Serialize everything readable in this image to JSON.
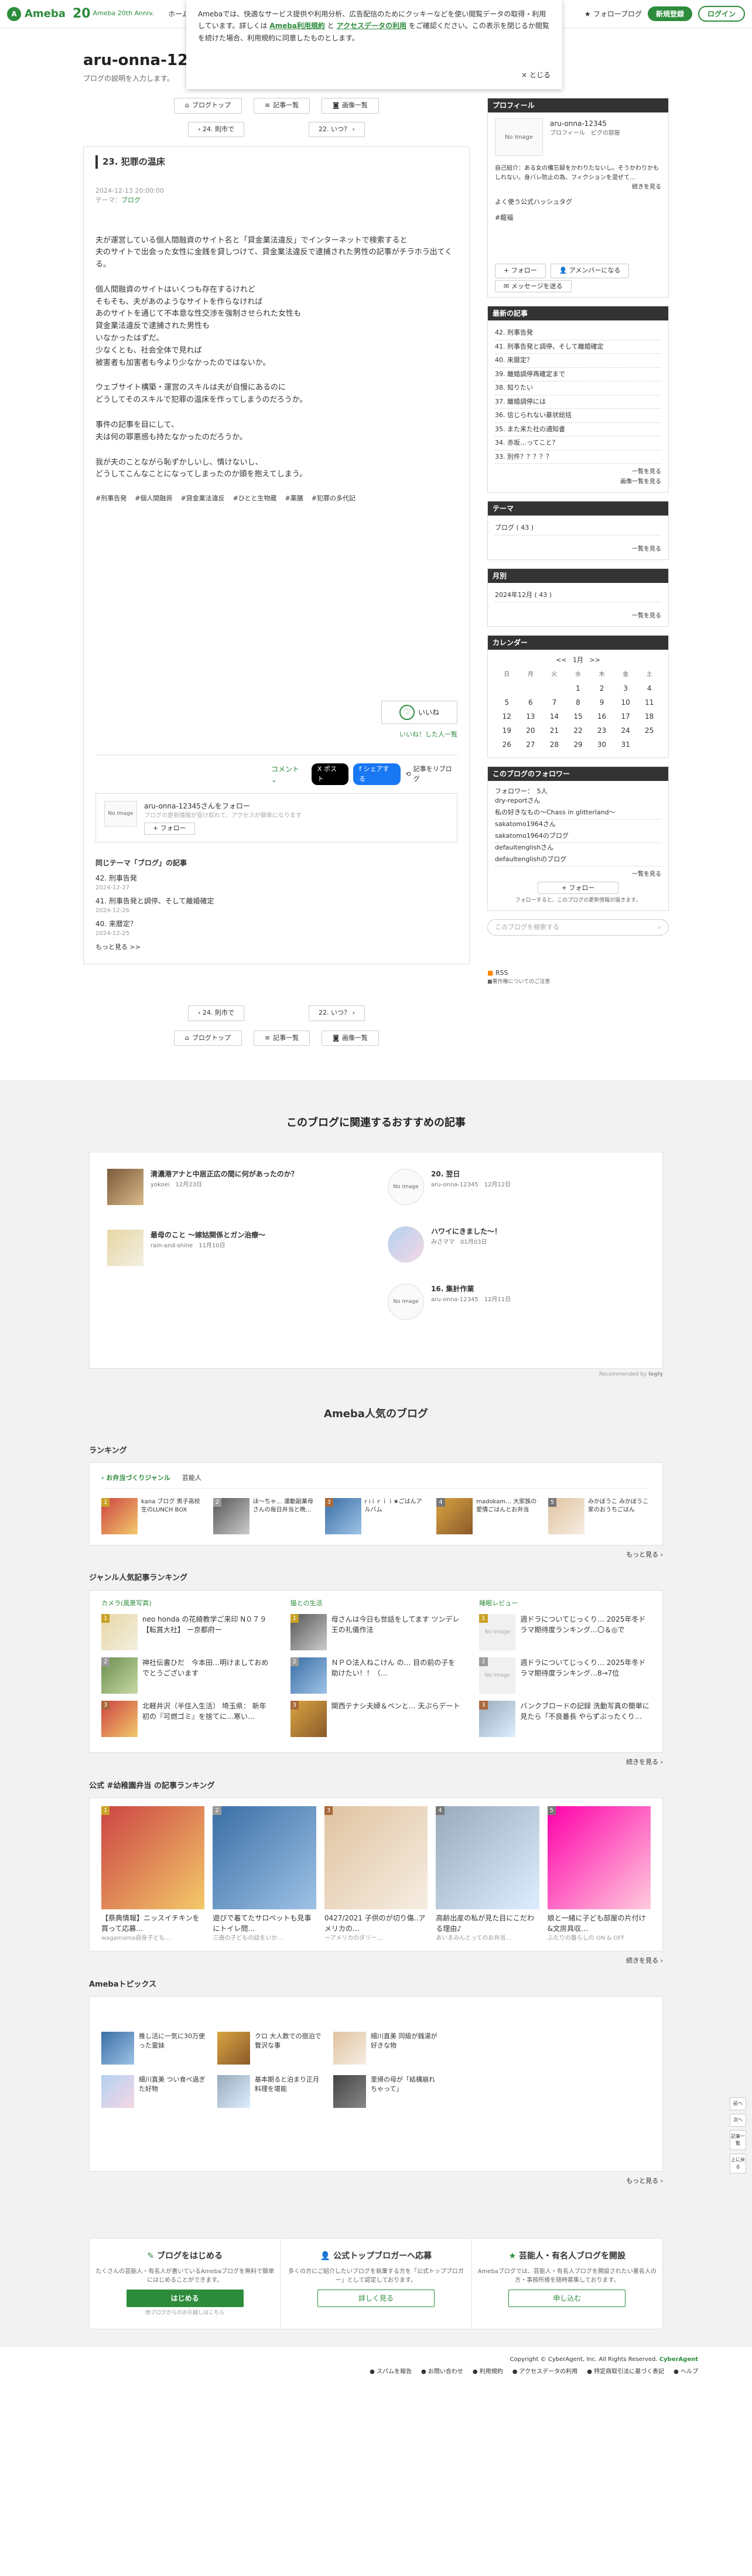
{
  "header": {
    "logo_text": "Ameba",
    "anniv_num": "20",
    "anniv_text": "Ameba 20th Anniv.",
    "nav": [
      "ホーム",
      "ブ"
    ],
    "fav_label": "フォローブログ",
    "signup_label": "新規登録",
    "login_label": "ログイン"
  },
  "cookie": {
    "text1": "Amebaでは、快適なサービス提供や利用分析、広告配信のためにクッキーなどを使い閲覧データの取得・利用しています。詳しくは",
    "link1": "Ameba利用規約",
    "and": "と",
    "link2": "アクセスデータの利用",
    "text2": "をご確認ください。この表示を閉じるか閲覧を続けた場合、利用規約に同意したものとします。",
    "close_label": "とじる"
  },
  "blog": {
    "title": "aru-onna-12345のブログ",
    "desc": "ブログの説明を入力します。"
  },
  "nav_buttons": {
    "top": "ブログトップ",
    "list": "記事一覧",
    "images": "画像一覧"
  },
  "pager": {
    "prev": "24. 則市で",
    "next": "22. いつ？"
  },
  "entry": {
    "title": "23. 犯罪の温床",
    "date": "2024-12-13 20:00:00",
    "theme_label": "テーマ：",
    "theme": "ブログ",
    "paragraphs": [
      [
        "夫が運営している個人間融資のサイト名と「貸金業法違反」でインターネットで検索すると",
        "夫のサイトで出会った女性に金銭を貸しつけて、貸金業法違反で逮捕された男性の記事がチラホラ出てくる。"
      ],
      [
        "個人間融資のサイトはいくつも存在するけれど",
        "そもそも、夫があのようなサイトを作らなければ",
        "あのサイトを通じて不本意な性交渉を強制させられた女性も",
        "貸金業法違反で逮捕された男性も",
        "いなかったはずだ。",
        "少なくとも、社会全体で見れば",
        "被害者も加害者も今より少なかったのではないか。"
      ],
      [
        "ウェブサイト構築・運営のスキルは夫が自慢にあるのに",
        "どうしてそのスキルで犯罪の温床を作ってしまうのだろうか。"
      ],
      [
        "事件の記事を目にして、",
        "夫は何の罪悪感も持たなかったのだろうか。"
      ],
      [
        "我が夫のことながら恥ずかしいし、情けないし、",
        "どうしてこんなことになってしまったのか頭を抱えてしまう。"
      ]
    ],
    "hashtags": [
      "#刑事告発",
      "#個人間融資",
      "#貸金業法違反",
      "#ひとと生物蔵",
      "#薬膳",
      "#犯罪の多代記"
    ],
    "iine_label": "いいね",
    "iine_list": "いいね！した人一覧",
    "comment_label": "コメント",
    "share_x": "ポスト",
    "share_fb": "シェアする",
    "reblog": "記事をリブログ"
  },
  "follow_box": {
    "name": "aru-onna-12345さんをフォロー",
    "sub": "ブログの更新情報が受け取れて、アクセスが簡単になります",
    "button": "フォロー",
    "avatar_text": "No Image"
  },
  "related": {
    "title": "同じテーマ「ブログ」の記事",
    "items": [
      {
        "title": "42. 刑事告発",
        "date": "2024-12-27"
      },
      {
        "title": "41. 刑事告発と調停、そして離婚確定",
        "date": "2024-12-26"
      },
      {
        "title": "40. 来暦定？",
        "date": "2024-12-25"
      }
    ],
    "more": "もっと見る >>"
  },
  "sidebar": {
    "profile": {
      "head": "プロフィール",
      "name": "aru-onna-12345",
      "links": "プロフィール　ピグの部屋",
      "desc": "自己紹介：ある女の備忘録をかわりたないし。そうかわりかもしれない。身バレ防止の為、フィクションを混ぜて…",
      "more": "続きを見る",
      "hash_label": "よく使う公式ハッシュタグ",
      "hash": "#龍福",
      "follow_btn": "フォロー",
      "member_btn": "アメンバーになる",
      "msg_btn": "メッセージを送る",
      "avatar_text": "No Image"
    },
    "recent": {
      "head": "最新の記事",
      "items": [
        "42. 刑事告発",
        "41. 刑事告発と調停、そして離婚確定",
        "40. 来暦定？",
        "39. 離婚調停再確定まで",
        "38. 知りたい",
        "37. 離婚調停には",
        "36. 信じられない暴状総括",
        "35. また来た社の通知書",
        "34. 赤坂…ってこと？",
        "33. 別件？？？？？"
      ],
      "more": "一覧を見る",
      "images": "画像一覧を見る"
    },
    "theme": {
      "head": "テーマ",
      "item": "ブログ ( 43 )",
      "more": "一覧を見る"
    },
    "monthly": {
      "head": "月別",
      "item": "2024年12月 ( 43 )",
      "more": "一覧を見る"
    },
    "calendar": {
      "head": "カレンダー",
      "prev": "<<",
      "month": "1月",
      "next": ">>",
      "days": [
        "日",
        "月",
        "火",
        "水",
        "木",
        "金",
        "土"
      ],
      "weeks": [
        [
          "",
          "",
          "",
          "1",
          "2",
          "3",
          "4"
        ],
        [
          "5",
          "6",
          "7",
          "8",
          "9",
          "10",
          "11"
        ],
        [
          "12",
          "13",
          "14",
          "15",
          "16",
          "17",
          "18"
        ],
        [
          "19",
          "20",
          "21",
          "22",
          "23",
          "24",
          "25"
        ],
        [
          "26",
          "27",
          "28",
          "29",
          "30",
          "31",
          ""
        ]
      ]
    },
    "followers": {
      "head": "このブログのフォロワー",
      "count": "フォロワー：　5人",
      "items": [
        "dry-reportさん",
        "私の好きなもの〜Chass in glitterland〜",
        "sakatomo1964さん",
        "sakatomo1964のブログ",
        "defaultenglishさん",
        "defaultenglishのブログ"
      ],
      "more": "一覧を見る",
      "follow_btn": "フォロー",
      "note": "フォローすると、このブログの更新情報が届きます。"
    },
    "search_placeholder": "このブログを検索する",
    "rss": "RSS",
    "rss_sub": "■著作権についてのご注意"
  },
  "recommend": {
    "title": "このブログに関連するおすすめの記事",
    "left": [
      {
        "title": "清濃港アナと中居正広の間に何があったのか？",
        "user": "yokoei",
        "date": "12月23日"
      },
      {
        "title": "最母のこと 〜嫁姑関係とガン治療〜",
        "user": "rain-and-shine",
        "date": "11月10日"
      }
    ],
    "right": [
      {
        "title": "20. 翌日",
        "user": "aru-onna-12345",
        "date": "12月12日",
        "img": "No Image"
      },
      {
        "title": "ハワイにきました〜！",
        "user": "みさママ",
        "date": "01月03日",
        "img": ""
      },
      {
        "title": "16. 集計作業",
        "user": "aru-onna-12345",
        "date": "12月11日",
        "img": "No Image"
      }
    ],
    "by": "Recommended by"
  },
  "popular": {
    "title": "Ameba人気のブログ",
    "ranking_title": "ランキング",
    "tabs": [
      "お弁当づくりジャンル",
      "芸能人"
    ],
    "rank": [
      {
        "no": "1",
        "name": "kana ブログ 男子高校生のLUNCH BOX"
      },
      {
        "no": "2",
        "name": "ほ〜ちゃ… 運動副業母さんの毎日弁当と晩…"
      },
      {
        "no": "3",
        "name": "r i i ｒｉｉ★ごはんアルバム"
      },
      {
        "no": "4",
        "name": "madokam… 大家族の愛情ごはんとお弁当"
      },
      {
        "no": "5",
        "name": "みかぼうこ みかぼうこ家のおうちごはん"
      }
    ],
    "more": "もっと見る"
  },
  "genre": {
    "title": "ジャンル人気記事ランキング",
    "cols": [
      {
        "head": "カメラ(風景写真)",
        "items": [
          {
            "no": "1",
            "text": "neo honda の花綺教学ご来印 N０７９ 【転賞大社】 ー京都府ー"
          },
          {
            "no": "2",
            "text": "神社伝書ひだ　今本田…明けましておめでとうございます"
          },
          {
            "no": "3",
            "text": "北軽井沢（半住入生活） 埼玉県： 新年初の『可燃ゴミ』を捨てに…寒い…"
          }
        ]
      },
      {
        "head": "猫との生活",
        "items": [
          {
            "no": "1",
            "text": "母さんは今日も世話をしてます ツンデレ王の礼儀作法"
          },
          {
            "no": "2",
            "text": "ＮＰＯ法人ねこけん の… 目の前の子を助けたい！！（…"
          },
          {
            "no": "3",
            "text": "関西テナシ夫婦＆ペンと… 天ぷらデート"
          }
        ]
      },
      {
        "head": "睡眠レビュー",
        "items": [
          {
            "no": "1",
            "text": "週ドラについてじっくり… 2025年冬ドラマ期待度ランキング…〇＆◎で"
          },
          {
            "no": "2",
            "text": "週ドラについてじっくり… 2025年冬ドラマ期待度ランキング…8→7位"
          },
          {
            "no": "3",
            "text": "バンクブロードの記録 洗動写真の簡単に見たら「不良番長 やらずぶったくり…"
          }
        ]
      }
    ],
    "more": "続きを見る"
  },
  "hashtag_rank": {
    "title": "公式 #幼稚園弁当 の記事ランキング",
    "items": [
      {
        "no": "1",
        "text": "【祭典情報】ニッスイチキンを買って応募…",
        "src": "wagamama自身子ども…"
      },
      {
        "no": "2",
        "text": "遊びで着てたサロペットも見事にトイレ問…",
        "src": "三歳の子どもの話をいか…"
      },
      {
        "no": "3",
        "text": "0427/2021 子供のが切り傷..アメリカの…",
        "src": "〜アメリカのダリー…"
      },
      {
        "no": "4",
        "text": "高齢出産の私が見た目にこだわる理由♪",
        "src": "あいまみんとってのお弁当…"
      },
      {
        "no": "5",
        "text": "娘と一緒に子ども部屋の片付け&文房具収…",
        "src": "ふたりの暮らしの ON & OFF"
      }
    ],
    "more": "続きを見る"
  },
  "topics": {
    "title": "Amebaトピックス",
    "items": [
      {
        "text": "推し活に一気に30万使った霊妹"
      },
      {
        "text": "クロ 大人数での宿泊で贅沢な事"
      },
      {
        "text": "細川直美 同級が銭湯が好きな物"
      },
      {
        "text": "細川直美 つい食べ過ぎた好物"
      },
      {
        "text": "基本期ると泊まり正月料理を堪能"
      },
      {
        "text": "里帰の母が「結構崩れちゃって」"
      }
    ],
    "more": "もっと見る"
  },
  "cta": [
    {
      "head": "ブログをはじめる",
      "desc": "たくさんの芸能人・有名人が書いているAmebaブログを無料で簡単にはじめることができます。",
      "btn": "はじめる",
      "foot": "他ブログからのお引越しはこちら"
    },
    {
      "head": "公式トップブロガーへ応募",
      "desc": "多くの方にご紹介したいブログを執筆する方を「公式トップブロガー」として認定しております。",
      "btn": "詳しく見る",
      "foot": ""
    },
    {
      "head": "芸能人・有名人ブログを開設",
      "desc": "Amebaブログでは、芸能人・有名人ブログを開設されたい著名人の方・事務所様を随時募集しております。",
      "btn": "申し込む",
      "foot": ""
    }
  ],
  "footer": {
    "copyright": "Copyright © CyberAgent, Inc. All Rights Reserved.",
    "brand": "CyberAgent",
    "links": [
      "スパムを報告",
      "お問い合わせ",
      "利用規約",
      "アクセスデータの利用",
      "特定商取引法に基づく表記",
      "ヘルプ"
    ]
  },
  "float_nav": [
    "前へ",
    "次へ",
    "記事一覧",
    "上に戻る"
  ]
}
